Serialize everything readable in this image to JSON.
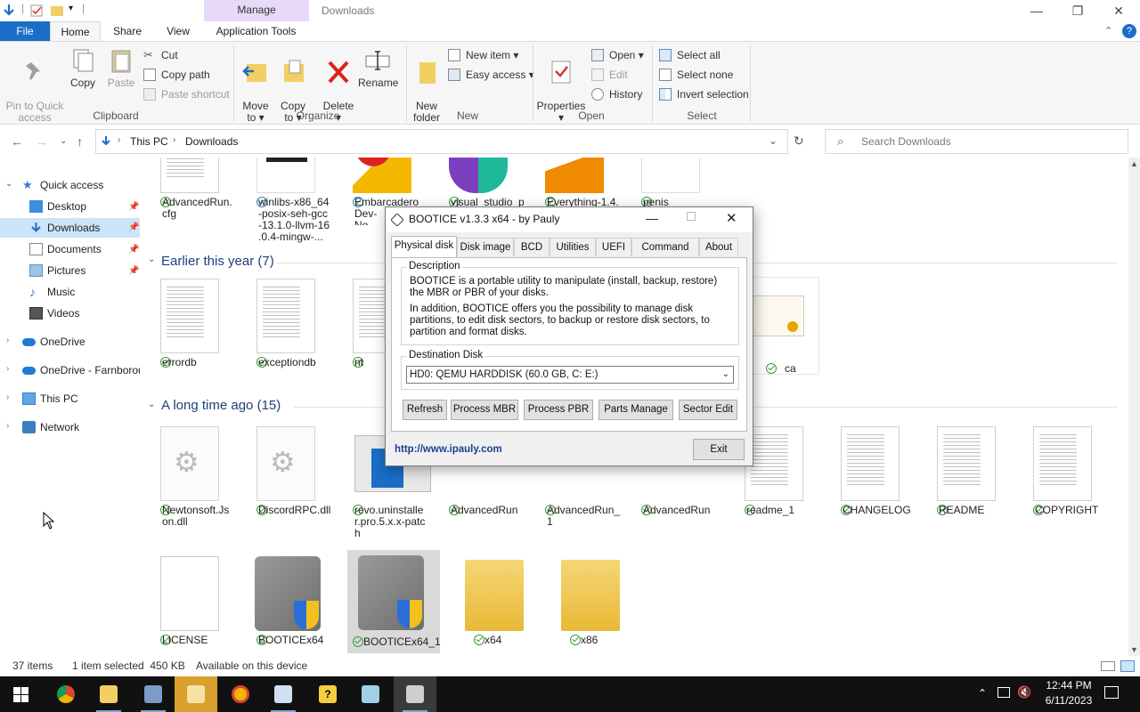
{
  "window": {
    "manage_tab": "Manage",
    "title": "Downloads"
  },
  "ribbon_tabs": [
    "File",
    "Home",
    "Share",
    "View",
    "Application Tools"
  ],
  "ribbon": {
    "clipboard": {
      "pin_label": "Pin to Quick\naccess",
      "copy_label": "Copy",
      "paste_label": "Paste",
      "cut_label": "Cut",
      "copy_path_label": "Copy path",
      "paste_shortcut_label": "Paste shortcut",
      "group_label": "Clipboard"
    },
    "organize": {
      "move_to_label": "Move\nto ▾",
      "copy_to_label": "Copy\nto ▾",
      "delete_label": "Delete\n▾",
      "rename_label": "Rename",
      "group_label": "Organize"
    },
    "new": {
      "new_folder_label": "New\nfolder",
      "new_item_label": "New item ▾",
      "easy_access_label": "Easy access ▾",
      "group_label": "New"
    },
    "open": {
      "properties_label": "Properties\n▾",
      "open_label": "Open ▾",
      "edit_label": "Edit",
      "history_label": "History",
      "group_label": "Open"
    },
    "select": {
      "select_all_label": "Select all",
      "select_none_label": "Select none",
      "invert_label": "Invert selection",
      "group_label": "Select"
    }
  },
  "address": {
    "crumbs": [
      "This PC",
      "Downloads"
    ],
    "search_placeholder": "Search Downloads"
  },
  "nav": {
    "quick_access": "Quick access",
    "items": [
      "Desktop",
      "Downloads",
      "Documents",
      "Pictures",
      "Music",
      "Videos"
    ],
    "onedrive": "OneDrive",
    "onedrive_farnborough": "OneDrive - Farnborou",
    "this_pc": "This PC",
    "network": "Network"
  },
  "content": {
    "top_row": [
      "AdvancedRun.\ncfg",
      "winlibs-x86_64\n-posix-seh-gcc\n-13.1.0-llvm-16\n.0.4-mingw-...",
      "Embarcadero_\nDev-\nNo_\nSetu",
      "visual_studio_p",
      "Everything-1.4.",
      "penis"
    ],
    "group_earlier": "Earlier this year (7)",
    "earlier_items": [
      "errordb",
      "exceptiondb",
      "nt",
      "ca"
    ],
    "group_long_ago": "A long time ago (15)",
    "long_ago_row1": [
      "Newtonsoft.Js\non.dll",
      "DiscordRPC.dll",
      "revo.uninstalle\nr.pro.5.x.x-patc\nh",
      "AdvancedRun",
      "AdvancedRun_\n1",
      "AdvancedRun",
      "readme_1",
      "CHANGELOG",
      "README",
      "COPYRIGHT"
    ],
    "long_ago_row2": [
      "LICENSE",
      "BOOTICEx64",
      "BOOTICEx64_1",
      "x64",
      "x86"
    ]
  },
  "status": {
    "count": "37 items",
    "selected": "1 item selected  450 KB",
    "availability": "Available on this device"
  },
  "dialog": {
    "title": "BOOTICE v1.3.3 x64 - by Pauly",
    "tabs": [
      "Physical disk",
      "Disk image",
      "BCD",
      "Utilities",
      "UEFI",
      "Command line",
      "About"
    ],
    "description_legend": "Description",
    "description_p1": "BOOTICE is a portable utility to manipulate (install, backup, restore) the MBR or PBR of your disks.",
    "description_p2": "In addition, BOOTICE offers you the possibility to manage disk partitions, to edit disk sectors, to backup or restore disk sectors, to partition and format disks.",
    "destination_legend": "Destination Disk",
    "destination_value": "HD0: QEMU HARDDISK (60.0 GB, C: E:)",
    "buttons": [
      "Refresh",
      "Process MBR",
      "Process PBR",
      "Parts Manage",
      "Sector Edit"
    ],
    "link": "http://www.ipauly.com",
    "exit": "Exit"
  },
  "taskbar": {
    "time": "12:44 PM",
    "date": "6/11/2023"
  },
  "colors": {
    "accent": "#1a6ec8",
    "manage_tab": "#e7daf7",
    "group_header": "#1f3f7a",
    "sync_check": "#3a9a3a"
  }
}
